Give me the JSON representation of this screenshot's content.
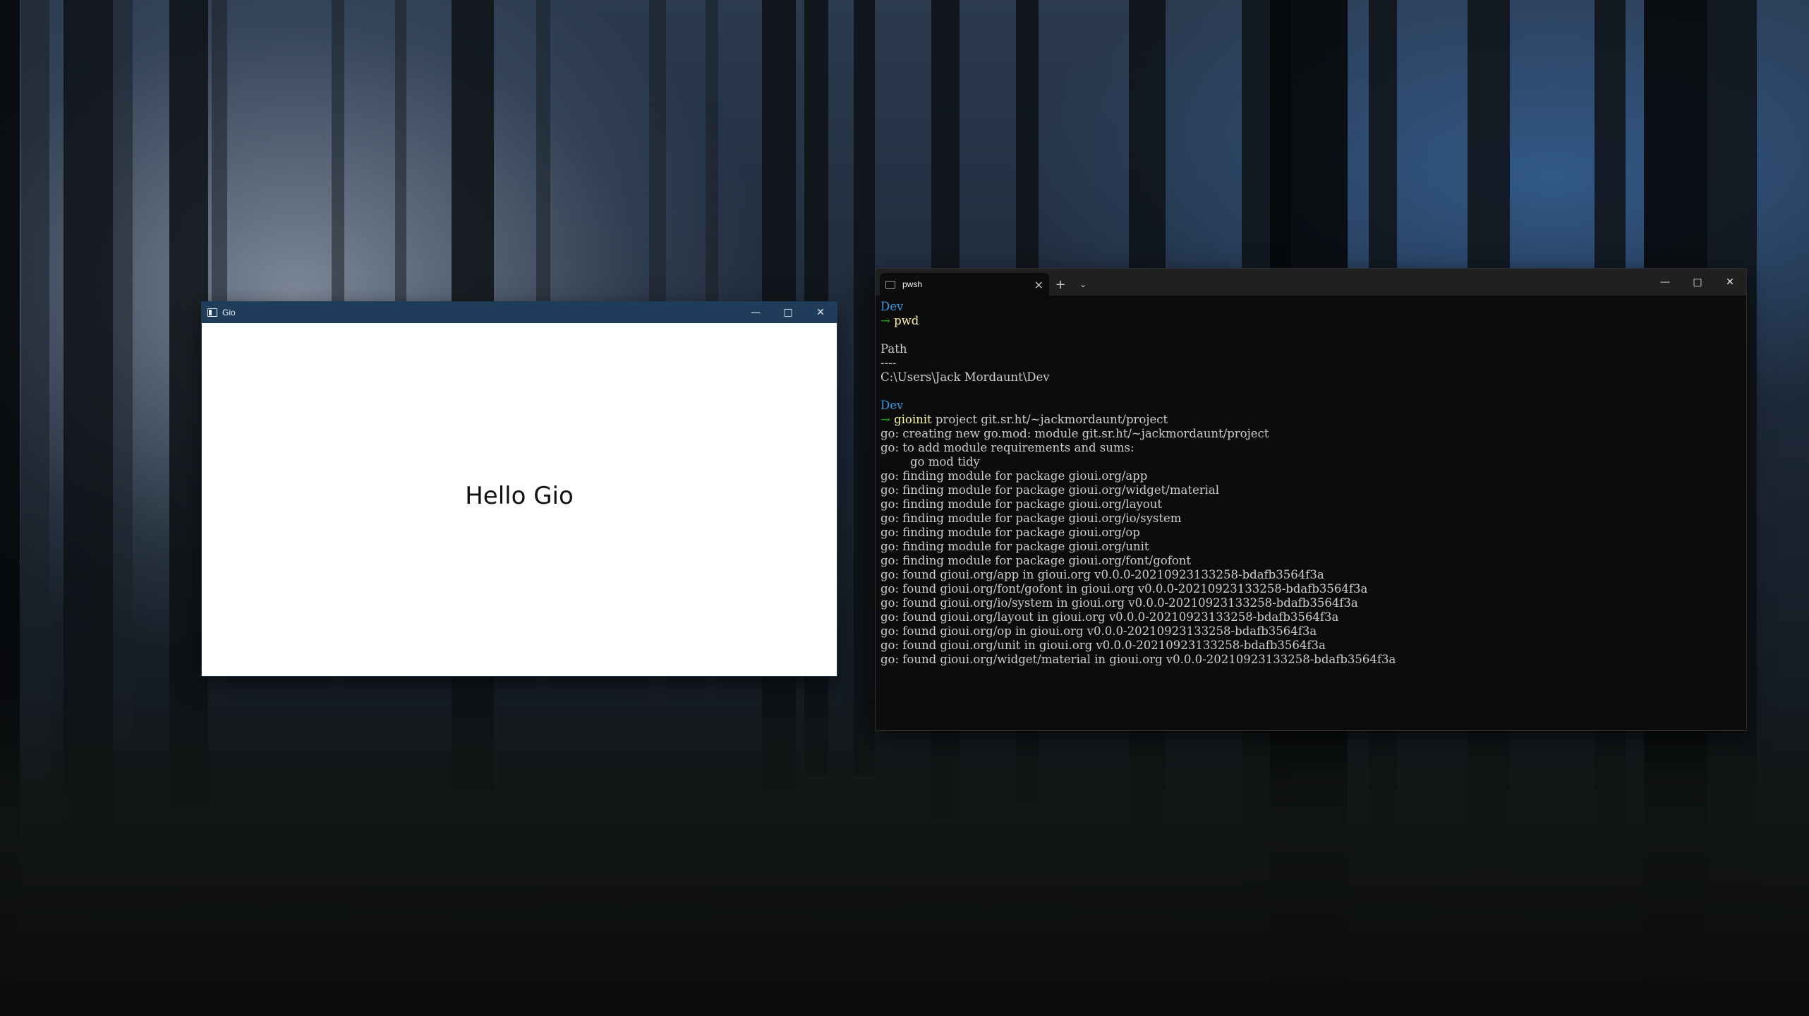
{
  "gio_window": {
    "title": "Gio",
    "content_text": "Hello Gio",
    "minimize_icon": "minimize-icon",
    "maximize_icon": "maximize-icon",
    "close_icon": "close-icon"
  },
  "terminal": {
    "tab_label": "pwsh",
    "new_tab": "+",
    "dropdown": "⌄",
    "lines": [
      {
        "kind": "dev",
        "text": "Dev"
      },
      {
        "kind": "prompt",
        "arrow": "→",
        "cmd": "pwd",
        "args": ""
      },
      {
        "kind": "blank",
        "text": ""
      },
      {
        "kind": "out",
        "text": "Path"
      },
      {
        "kind": "out",
        "text": "----"
      },
      {
        "kind": "out",
        "text": "C:\\Users\\Jack Mordaunt\\Dev"
      },
      {
        "kind": "blank",
        "text": ""
      },
      {
        "kind": "dev",
        "text": "Dev"
      },
      {
        "kind": "prompt",
        "arrow": "→",
        "cmd": "gioinit",
        "args": " project git.sr.ht/~jackmordaunt/project"
      },
      {
        "kind": "out",
        "text": "go: creating new go.mod: module git.sr.ht/~jackmordaunt/project"
      },
      {
        "kind": "out",
        "text": "go: to add module requirements and sums:"
      },
      {
        "kind": "out",
        "text": "        go mod tidy"
      },
      {
        "kind": "out",
        "text": "go: finding module for package gioui.org/app"
      },
      {
        "kind": "out",
        "text": "go: finding module for package gioui.org/widget/material"
      },
      {
        "kind": "out",
        "text": "go: finding module for package gioui.org/layout"
      },
      {
        "kind": "out",
        "text": "go: finding module for package gioui.org/io/system"
      },
      {
        "kind": "out",
        "text": "go: finding module for package gioui.org/op"
      },
      {
        "kind": "out",
        "text": "go: finding module for package gioui.org/unit"
      },
      {
        "kind": "out",
        "text": "go: finding module for package gioui.org/font/gofont"
      },
      {
        "kind": "out",
        "text": "go: found gioui.org/app in gioui.org v0.0.0-20210923133258-bdafb3564f3a"
      },
      {
        "kind": "out",
        "text": "go: found gioui.org/font/gofont in gioui.org v0.0.0-20210923133258-bdafb3564f3a"
      },
      {
        "kind": "out",
        "text": "go: found gioui.org/io/system in gioui.org v0.0.0-20210923133258-bdafb3564f3a"
      },
      {
        "kind": "out",
        "text": "go: found gioui.org/layout in gioui.org v0.0.0-20210923133258-bdafb3564f3a"
      },
      {
        "kind": "out",
        "text": "go: found gioui.org/op in gioui.org v0.0.0-20210923133258-bdafb3564f3a"
      },
      {
        "kind": "out",
        "text": "go: found gioui.org/unit in gioui.org v0.0.0-20210923133258-bdafb3564f3a"
      },
      {
        "kind": "out",
        "text": "go: found gioui.org/widget/material in gioui.org v0.0.0-20210923133258-bdafb3564f3a"
      }
    ]
  },
  "colors": {
    "gio_titlebar": "#1f3d5b",
    "terminal_bg": "#0c0c0c",
    "prompt_dir": "#3a96dd",
    "prompt_arrow": "#13a10e",
    "command": "#f9f1a5",
    "output": "#cccccc"
  }
}
